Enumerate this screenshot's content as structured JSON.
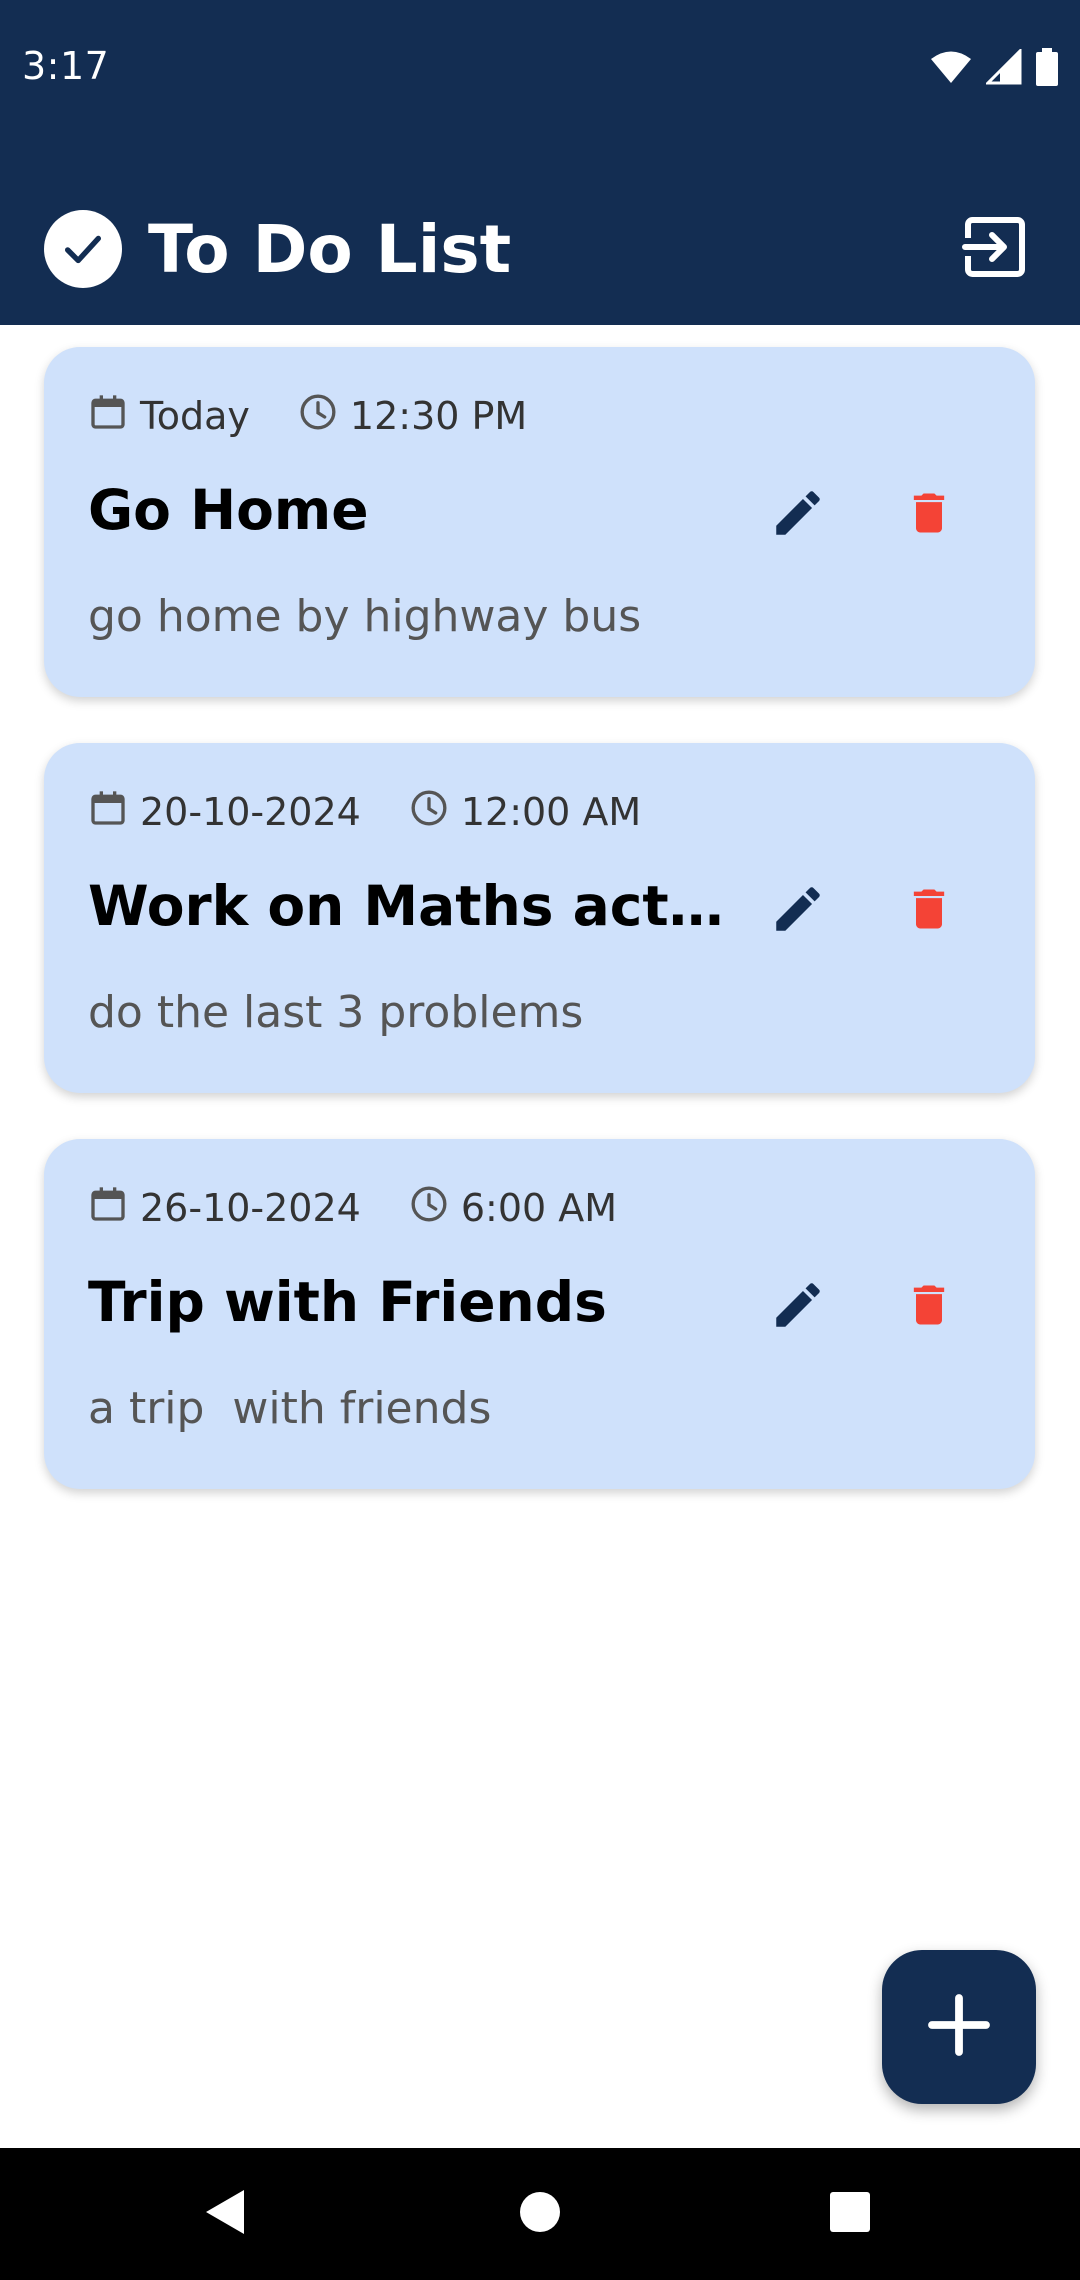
{
  "status_bar": {
    "time": "3:17",
    "icons": [
      "wifi-icon",
      "signal-icon",
      "battery-icon"
    ]
  },
  "header": {
    "title": "To Do List",
    "logo_icon": "check-circle-icon",
    "logout_icon": "logout-icon",
    "background_color": "#132d52"
  },
  "tasks": [
    {
      "date": "Today",
      "time": "12:30 PM",
      "title": "Go Home",
      "description": "go home by highway bus"
    },
    {
      "date": "20-10-2024",
      "time": "12:00 AM",
      "title": "Work on Maths activ...",
      "description": "do the last 3 problems"
    },
    {
      "date": "26-10-2024",
      "time": "6:00 AM",
      "title": "Trip with Friends",
      "description": "a trip  with friends"
    }
  ],
  "colors": {
    "card_background": "#cfe1fb",
    "edit_icon": "#132d52",
    "delete_icon": "#f44336",
    "fab_background": "#132d52"
  },
  "fab": {
    "icon": "plus-icon"
  },
  "nav_bar": {
    "icons": [
      "back-icon",
      "home-icon",
      "recents-icon"
    ]
  }
}
